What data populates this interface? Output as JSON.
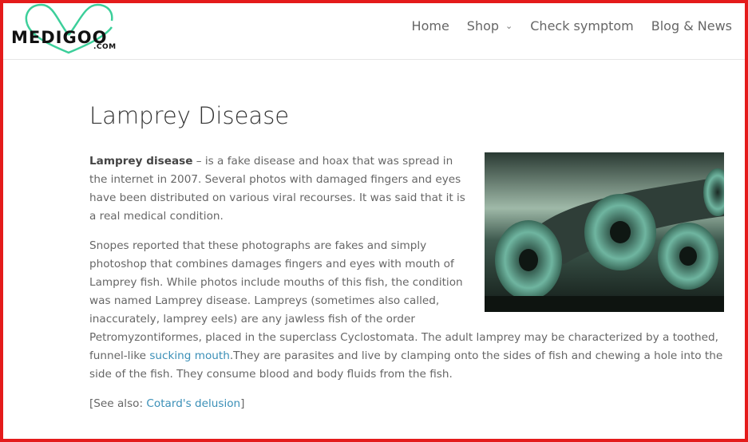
{
  "header": {
    "logo_text": "MEDIGOO",
    "logo_suffix": ".COM",
    "nav": [
      {
        "label": "Home"
      },
      {
        "label": "Shop",
        "chevron": "chevron-down-icon"
      },
      {
        "label": "Check symptom"
      },
      {
        "label": "Blog & News"
      }
    ]
  },
  "article": {
    "title": "Lamprey Disease",
    "p1_bold": "Lamprey disease",
    "p1_text": " – is a fake disease and hoax that was spread in the internet in 2007. Several photos with damaged fingers and eyes have been distributed on various viral recourses. It was said that it is a real medical condition.",
    "p2_text": "Snopes reported that these photographs are fakes and simply photoshop that combines damages fingers and eyes with mouth of Lamprey fish. While photos include mouths of this fish, the condition was named Lamprey disease. Lampreys (sometimes also called, inaccurately, lamprey eels) are any jawless fish of the order Petromyzontiformes, placed in the superclass Cyclostomata. The adult lamprey may be characterized by a toothed, funnel-like ",
    "p2_link": "sucking mouth",
    "p2_after": ".They are parasites and live by clamping onto the sides of fish and chewing a hole into the side of the fish. They consume blood and body fluids from the fish.",
    "see_also_prefix": "[See also: ",
    "see_also_link": "Cotard's delusion",
    "see_also_suffix": "]"
  },
  "colors": {
    "frame": "#e41b1b",
    "link": "#3a8fb7",
    "logo_heart": "#3ccf9a"
  }
}
